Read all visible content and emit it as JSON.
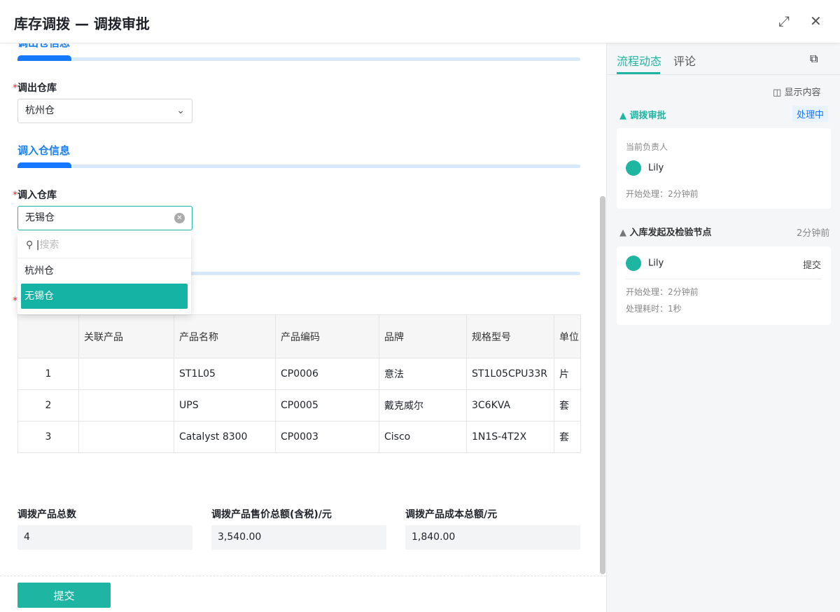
{
  "window": {
    "title": "库存调拨 — 调拨审批"
  },
  "form": {
    "out_section": "调出仓信息",
    "out_label": "调出仓库",
    "out_value": "杭州仓",
    "in_section": "调入仓信息",
    "in_label": "调入仓库",
    "in_value": "无锡仓",
    "dropdown": {
      "placeholder": "搜索",
      "options": [
        "杭州仓",
        "无锡仓"
      ],
      "selected": "无锡仓"
    },
    "required_mark": "*"
  },
  "table": {
    "columns": [
      "关联产品",
      "产品名称",
      "产品编码",
      "品牌",
      "规格型号",
      "单位"
    ],
    "rows": [
      {
        "idx": "1",
        "rel": "",
        "name": "ST1L05",
        "code": "CP0006",
        "brand": "意法",
        "spec": "ST1L05CPU33R",
        "unit": "片"
      },
      {
        "idx": "2",
        "rel": "",
        "name": "UPS",
        "code": "CP0005",
        "brand": "戴克威尔",
        "spec": "3C6KVA",
        "unit": "套"
      },
      {
        "idx": "3",
        "rel": "",
        "name": "Catalyst 8300",
        "code": "CP0003",
        "brand": "Cisco",
        "spec": "1N1S-4T2X",
        "unit": "套"
      }
    ]
  },
  "summary": [
    {
      "label": "调拨产品总数",
      "value": "4"
    },
    {
      "label": "调拨产品售价总额(含税)/元",
      "value": "3,540.00"
    },
    {
      "label": "调拨产品成本总额/元",
      "value": "1,840.00"
    }
  ],
  "footer": {
    "submit": "提交"
  },
  "side": {
    "tabs": [
      "流程动态",
      "评论"
    ],
    "show_content": "显示内容",
    "node1": {
      "title": "调拨审批",
      "status": "处理中",
      "owner_label": "当前负责人",
      "user": "Lily",
      "start": "开始处理：2分钟前"
    },
    "node2": {
      "title": "入库发起及检验节点",
      "time": "2分钟前",
      "user": "Lily",
      "action": "提交",
      "start": "开始处理：2分钟前",
      "duration": "处理耗时：1秒"
    }
  },
  "colors": {
    "accent": "#1fb5a3",
    "blue": "#1677ff"
  }
}
